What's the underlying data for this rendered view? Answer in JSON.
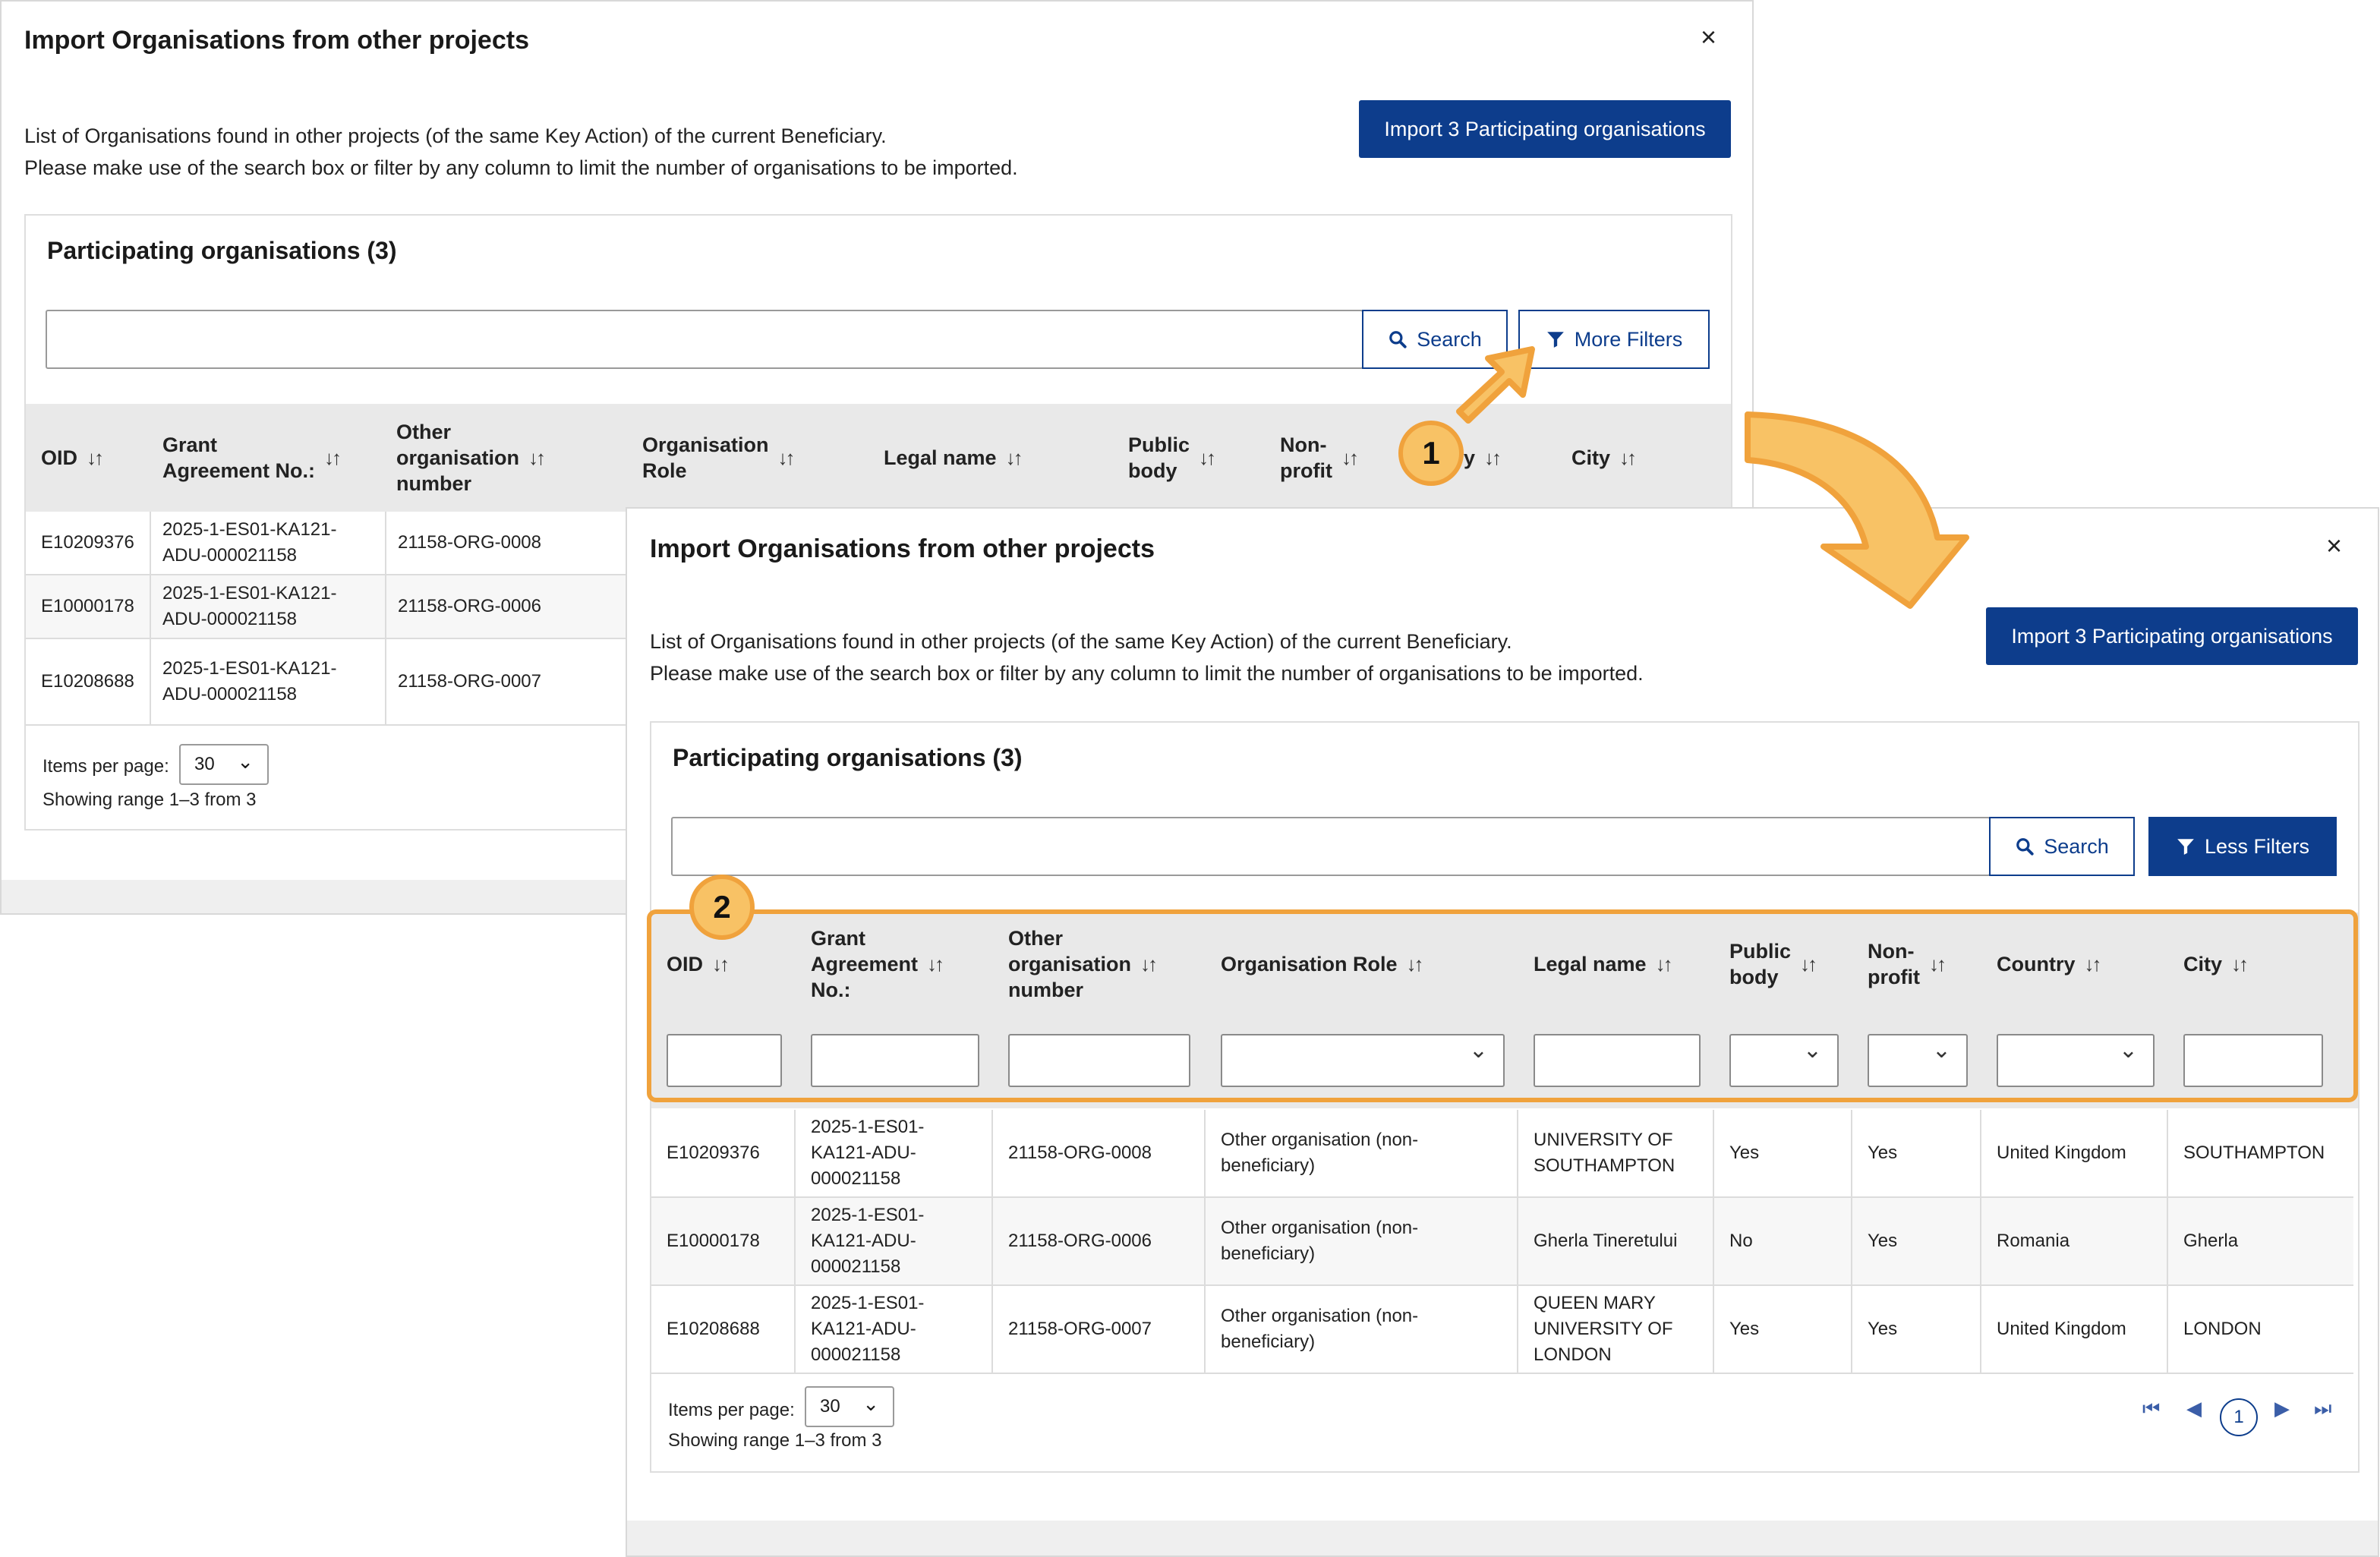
{
  "dialog": {
    "title": "Import Organisations from other projects",
    "close": "×",
    "intro_line1": "List of Organisations found in other projects (of the same Key Action) of the current Beneficiary.",
    "intro_line2": "Please make use of the search box or filter by any column to limit the number of organisations to be imported.",
    "import_button": "Import 3 Participating organisations",
    "panel_title": "Participating organisations (3)",
    "search_button": "Search",
    "more_filters_button": "More Filters",
    "less_filters_button": "Less Filters",
    "items_per_page_label": "Items per page:",
    "items_per_page_value": "30",
    "range_text": "Showing range 1–3 from 3",
    "current_page": "1"
  },
  "back_headers": [
    [
      "OID"
    ],
    [
      "Grant",
      "Agreement No.:"
    ],
    [
      "Other",
      "organisation",
      "number"
    ],
    [
      "Organisation",
      "Role"
    ],
    [
      "Legal name"
    ],
    [
      "Public",
      "body"
    ],
    [
      "Non-",
      "profit"
    ],
    [
      "ntry"
    ],
    [
      "City"
    ]
  ],
  "front_headers": [
    [
      "OID"
    ],
    [
      "Grant",
      "Agreement",
      "No.:"
    ],
    [
      "Other",
      "organisation",
      "number"
    ],
    [
      "Organisation Role"
    ],
    [
      "Legal name"
    ],
    [
      "Public",
      "body"
    ],
    [
      "Non-",
      "profit"
    ],
    [
      "Country"
    ],
    [
      "City"
    ]
  ],
  "back_rows": [
    {
      "oid": "E10209376",
      "grant": [
        "2025-1-ES01-KA121-",
        "ADU-000021158"
      ],
      "other": "21158-ORG-0008"
    },
    {
      "oid": "E10000178",
      "grant": [
        "2025-1-ES01-KA121-",
        "ADU-000021158"
      ],
      "other": "21158-ORG-0006"
    },
    {
      "oid": "E10208688",
      "grant": [
        "2025-1-ES01-KA121-",
        "ADU-000021158"
      ],
      "other": "21158-ORG-0007"
    }
  ],
  "rows": [
    {
      "oid": "E10209376",
      "grant": [
        "2025-1-ES01-",
        "KA121-ADU-",
        "000021158"
      ],
      "other": "21158-ORG-0008",
      "role": [
        "Other organisation (non-",
        "beneficiary)"
      ],
      "legal": [
        "UNIVERSITY OF",
        "SOUTHAMPTON"
      ],
      "public": "Yes",
      "nonprofit": "Yes",
      "country": "United Kingdom",
      "city": "SOUTHAMPTON"
    },
    {
      "oid": "E10000178",
      "grant": [
        "2025-1-ES01-",
        "KA121-ADU-",
        "000021158"
      ],
      "other": "21158-ORG-0006",
      "role": [
        "Other organisation (non-",
        "beneficiary)"
      ],
      "legal": [
        "Gherla Tineretului"
      ],
      "public": "No",
      "nonprofit": "Yes",
      "country": "Romania",
      "city": "Gherla"
    },
    {
      "oid": "E10208688",
      "grant": [
        "2025-1-ES01-",
        "KA121-ADU-",
        "000021158"
      ],
      "other": "21158-ORG-0007",
      "role": [
        "Other organisation (non-",
        "beneficiary)"
      ],
      "legal": [
        "QUEEN MARY",
        "UNIVERSITY OF",
        "LONDON"
      ],
      "public": "Yes",
      "nonprofit": "Yes",
      "country": "United Kingdom",
      "city": "LONDON"
    }
  ],
  "callouts": {
    "step1": "1",
    "step2": "2"
  },
  "colors": {
    "primary": "#0d3d8c",
    "callout": "#f0a23c",
    "callout_fill": "#f8c265"
  },
  "icons": {
    "search": "search-icon",
    "filter": "filter-icon",
    "close": "close-icon",
    "sort": "sort-icon",
    "chevron": "chevron-down-icon"
  }
}
